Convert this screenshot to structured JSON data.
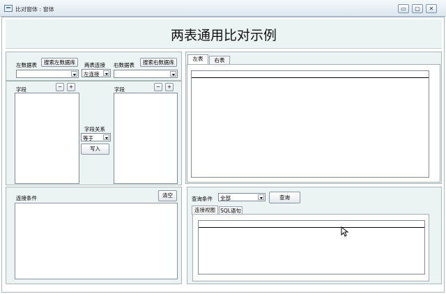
{
  "window": {
    "title": "比对窗体 : 窗体",
    "min": "▭",
    "max": "▢",
    "close": "✕"
  },
  "page_title": "两表通用比对示例",
  "left_table": {
    "label": "左数据表",
    "search_button": "搜索左数据库",
    "value": ""
  },
  "join": {
    "label": "两表连接",
    "value": "左连接"
  },
  "right_table": {
    "label": "右数据表",
    "search_button": "搜索右数据库",
    "value": ""
  },
  "left_fields": {
    "label": "字段",
    "minus": "−",
    "plus": "+"
  },
  "right_fields": {
    "label": "字段",
    "minus": "−",
    "plus": "+"
  },
  "relation": {
    "label": "字段关系",
    "value": "等于",
    "write_button": "写入"
  },
  "join_condition": {
    "label": "连接条件",
    "clear_button": "清空"
  },
  "top_tabs": [
    "左表",
    "右表"
  ],
  "query": {
    "label": "查询条件",
    "value": "全部",
    "query_button": "查询"
  },
  "bottom_tabs": [
    "连接视图",
    "SQL语句"
  ]
}
